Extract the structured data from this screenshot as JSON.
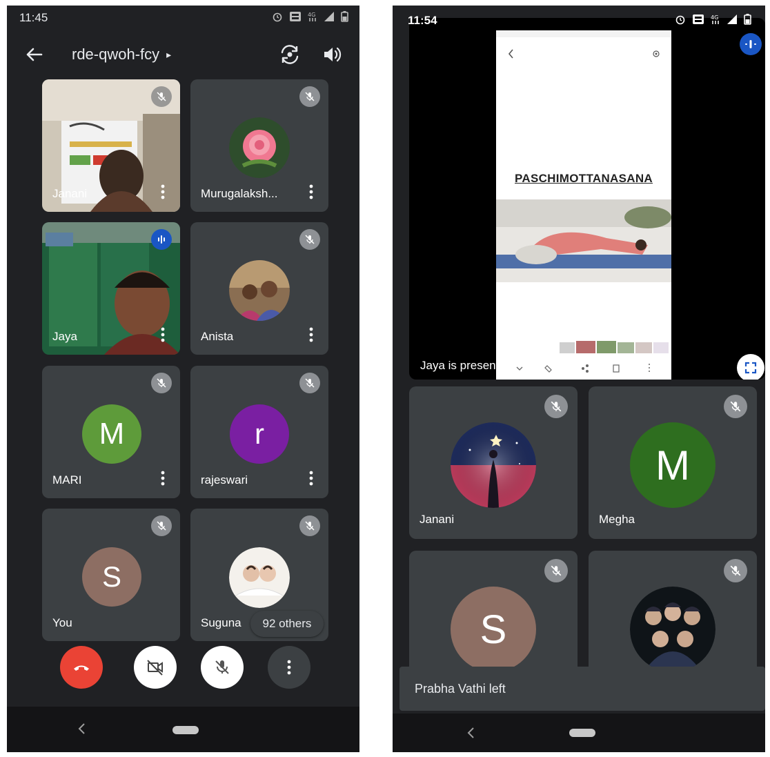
{
  "phone_a": {
    "status_time": "11:45",
    "meeting_code": "rde-qwoh-fcy",
    "caret": "▸",
    "tiles": [
      {
        "name": "Janani"
      },
      {
        "name": "Murugalaksh..."
      },
      {
        "name": "Jaya"
      },
      {
        "name": "Anista"
      },
      {
        "name": "MARI",
        "initial": "M",
        "color": "#5e9b3a"
      },
      {
        "name": "rajeswari",
        "initial": "r",
        "color": "#7a1fa2"
      },
      {
        "name": "You",
        "initial": "S",
        "color": "#8d6e63"
      },
      {
        "name": "Suguna"
      }
    ],
    "others_badge": "92 others",
    "end_call_color": "#ea4335"
  },
  "phone_b": {
    "status_time": "11:54",
    "presentation_slide_title": "PASCHIMOTTANASANA",
    "presenting_label": "Jaya is presenting",
    "tiles": [
      {
        "name": "Janani"
      },
      {
        "name": "Megha",
        "initial": "M",
        "color": "#2e6e1f"
      },
      {
        "name": "",
        "initial": "S",
        "color": "#8d6e63"
      },
      {
        "name": ""
      }
    ],
    "toast": "Prabha Vathi left"
  },
  "accent_blue": "#1a56c4"
}
